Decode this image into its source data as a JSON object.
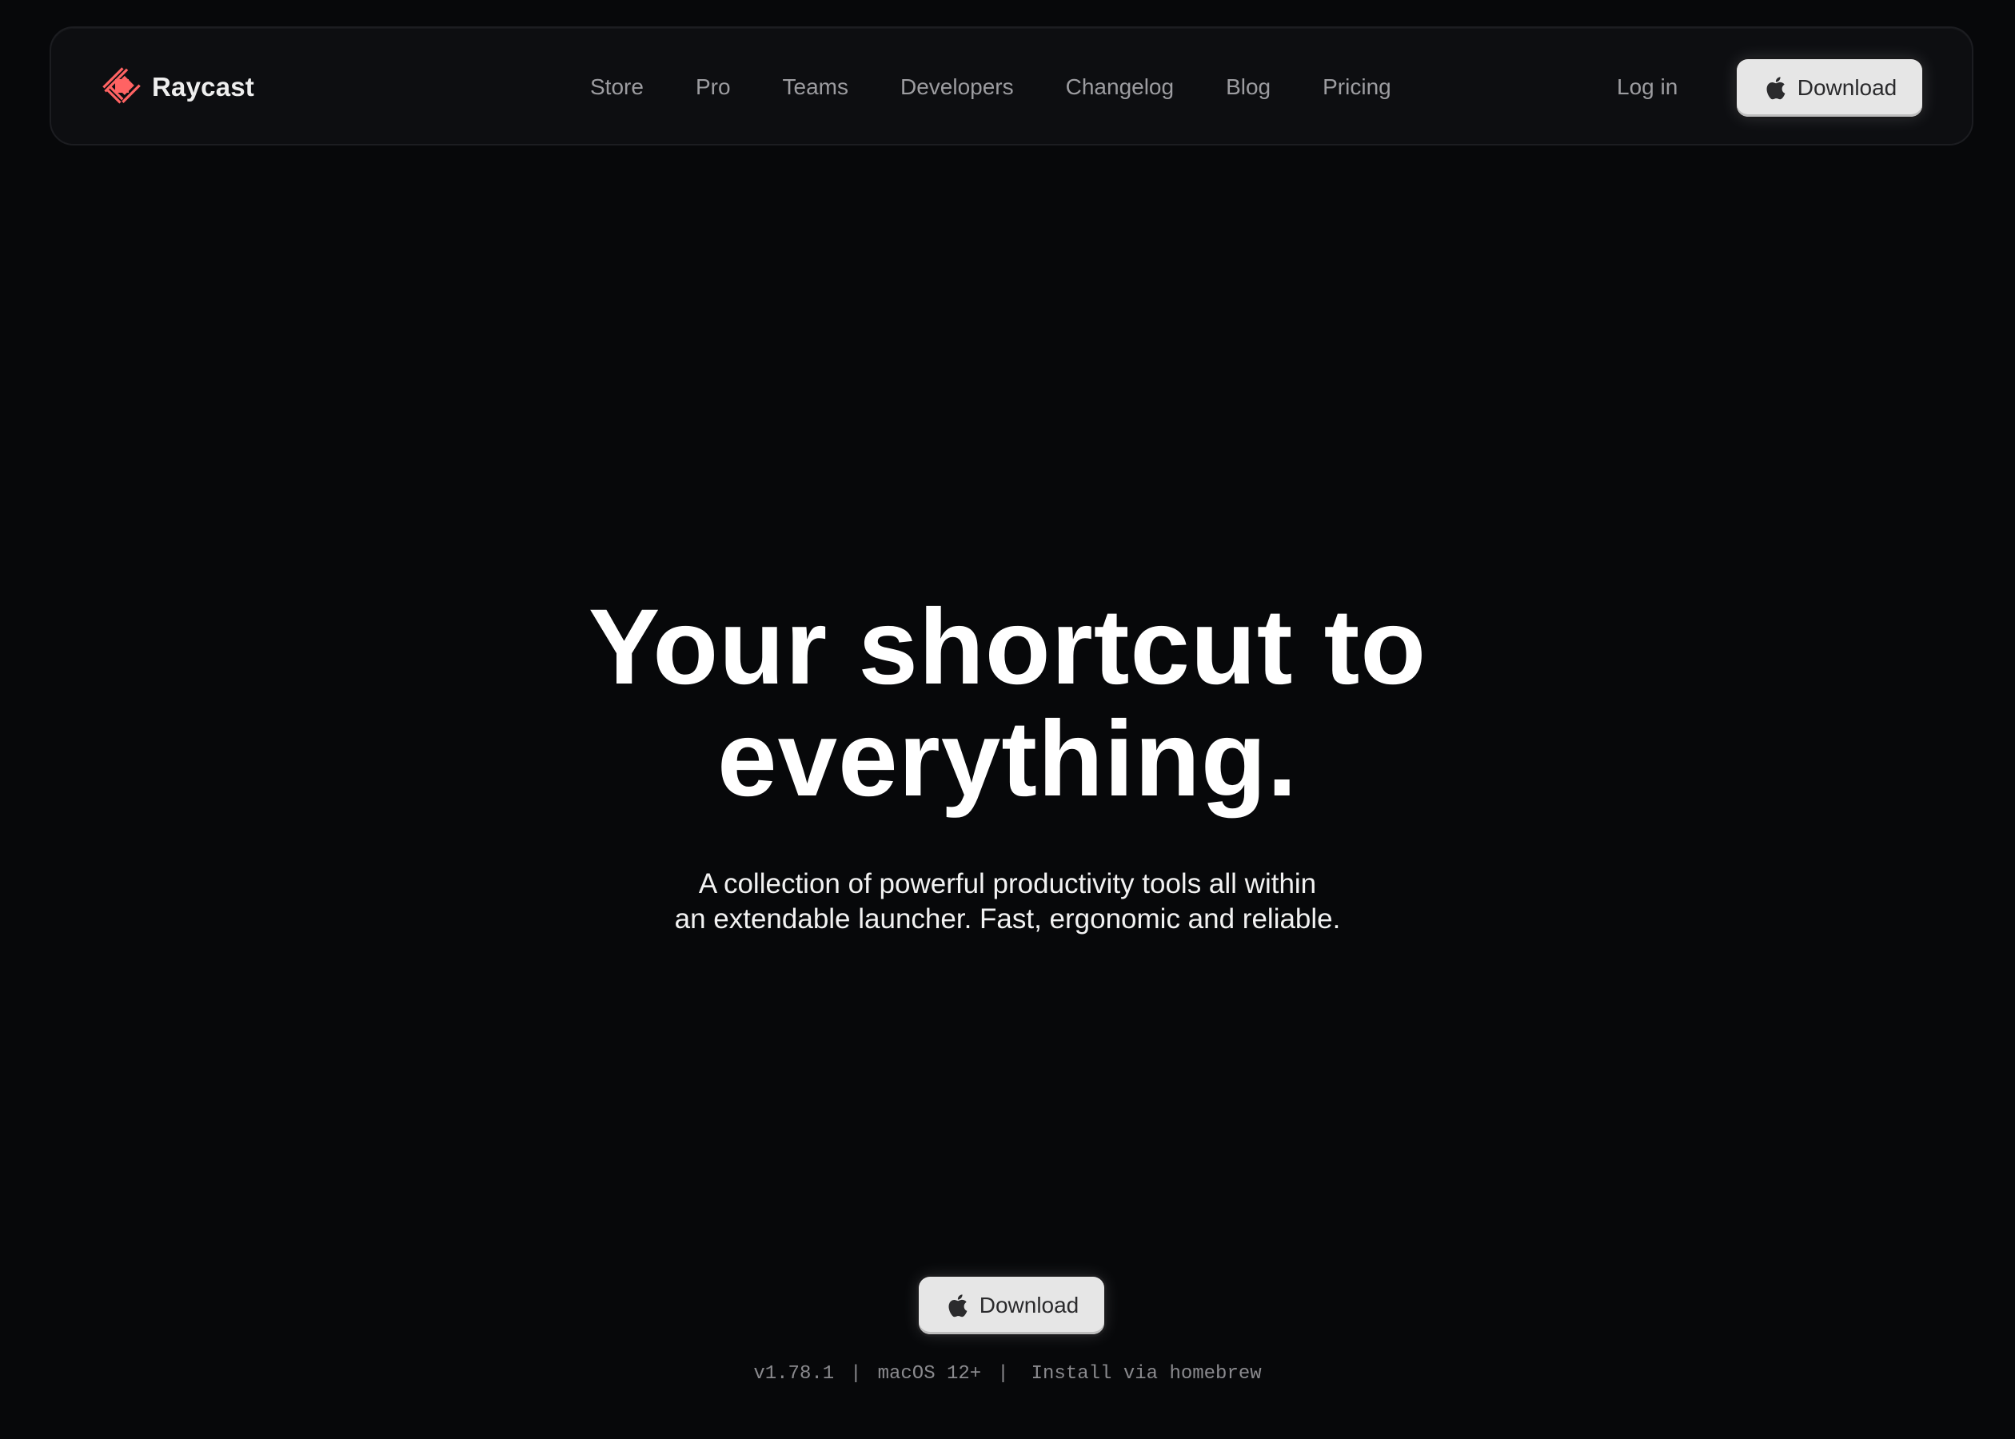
{
  "brand": {
    "name": "Raycast",
    "logo_icon": "raycast-logo-icon",
    "accent_color": "#ff6363"
  },
  "nav": {
    "links": [
      {
        "label": "Store"
      },
      {
        "label": "Pro"
      },
      {
        "label": "Teams"
      },
      {
        "label": "Developers"
      },
      {
        "label": "Changelog"
      },
      {
        "label": "Blog"
      },
      {
        "label": "Pricing"
      }
    ],
    "login_label": "Log in",
    "download_label": "Download",
    "download_icon": "apple-icon"
  },
  "hero": {
    "title_line1": "Your shortcut to",
    "title_line2": "everything.",
    "subtitle_line1": "A collection of powerful productivity tools all within",
    "subtitle_line2": "an extendable launcher. Fast, ergonomic and reliable.",
    "download_label": "Download",
    "download_icon": "apple-icon"
  },
  "meta": {
    "version": "v1.78.1",
    "separator": "|",
    "os_requirement": "macOS 12+",
    "homebrew_label": "Install via homebrew"
  }
}
